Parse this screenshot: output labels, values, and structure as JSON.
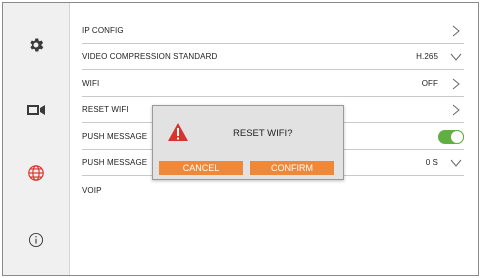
{
  "sidebar": {
    "items": [
      {
        "icon": "gear-icon"
      },
      {
        "icon": "video-camera-icon"
      },
      {
        "icon": "network-globe-icon",
        "color": "#d9342b"
      },
      {
        "icon": "info-icon"
      }
    ]
  },
  "settings": {
    "ip_config": {
      "label": "IP CONFIG"
    },
    "video_compression": {
      "label": "VIDEO COMPRESSION STANDARD",
      "value": "H.265"
    },
    "wifi": {
      "label": "WIFI",
      "value": "OFF"
    },
    "reset_wifi": {
      "label": "RESET WIFI"
    },
    "push_message_1": {
      "label": "PUSH MESSAGE",
      "toggle_on": true
    },
    "push_message_2": {
      "label": "PUSH MESSAGE",
      "value": "0 S"
    },
    "voip": {
      "label": "VOIP"
    }
  },
  "dialog": {
    "title": "RESET WIFI?",
    "cancel_label": "CANCEL",
    "confirm_label": "CONFIRM"
  },
  "colors": {
    "accent": "#f0883a",
    "toggle_on": "#5fb040",
    "warning": "#d9342b",
    "sidebar_bg": "#f0f0f0"
  }
}
